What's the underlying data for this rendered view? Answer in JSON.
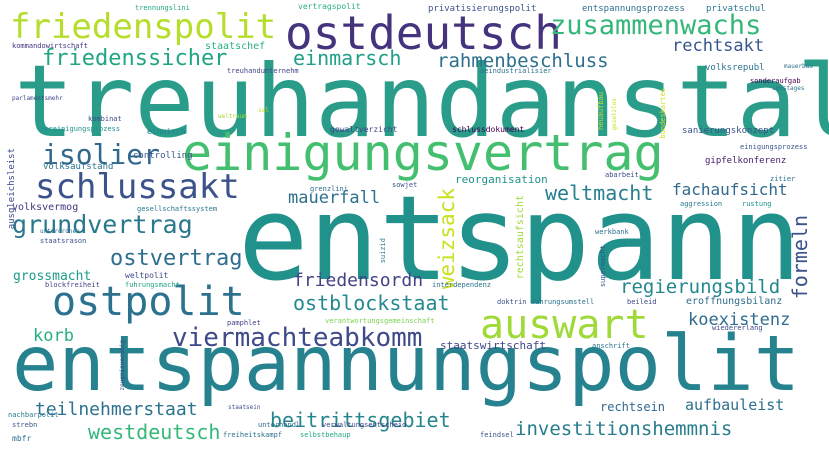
{
  "words": {
    "treuhandanstalt": "treuhandanstalt",
    "entspann": "entspann",
    "entspannungspolit": "entspannungspolit",
    "einigungsvertrag": "einigungsvertrag",
    "ostdeutsch": "ostdeutsch",
    "friedenspolit": "friedenspolit",
    "zusammenwachs": "zusammenwachs",
    "ostpolit": "ostpolit",
    "auswart": "auswart",
    "schlussakt": "schlussakt",
    "viermachteabkomm": "viermachteabkomm",
    "grundvertrag": "grundvertrag",
    "weltmacht": "weltmacht",
    "isolier": "isolier",
    "rahmenbeschluss": "rahmenbeschluss",
    "friedenssicher": "friedenssicher",
    "einmarsch": "einmarsch",
    "rechtsakt": "rechtsakt",
    "ostvertrag": "ostvertrag",
    "weizsack": "weizsack",
    "mauerfall": "mauerfall",
    "fachaufsicht": "fachaufsicht",
    "formeln": "formeln",
    "regierungsbild": "regierungsbild",
    "ostblockstaat": "ostblockstaat",
    "friedensordn": "friedensordn",
    "grossmacht": "grossmacht",
    "korb": "korb",
    "koexistenz": "koexistenz",
    "teilnehmerstaat": "teilnehmerstaat",
    "westdeutsch": "westdeutsch",
    "beitrittsgebiet": "beitrittsgebiet",
    "investitionshemmnis": "investitionshemmnis",
    "aufbauleist": "aufbauleist",
    "rechtsein": "rechtsein",
    "staatswirtschaft": "staatswirtschaft",
    "reorganisation": "reorganisation",
    "staatschef": "staatschef",
    "volksvermog": "volksvermog",
    "sanierungskonzept": "sanierungskonzept",
    "gipfelkonferenz": "gipfelkonferenz",
    "eroffnungsbilanz": "eroffnungsbilanz",
    "controlling": "controlling",
    "gewaltverzicht": "gewaltverzicht",
    "schlussdokument": "schlussdokument",
    "ausgleichsleist": "ausgleichsleist",
    "volksaufstand": "volksaufstand",
    "einmisch": "einmisch",
    "vereinigungsprozess": "vereinigungsprozess",
    "kombinat": "kombinat",
    "volksrepubl": "volksrepubl",
    "sonderaufgab": "sonderaufgab",
    "entspannungsprozess": "entspannungsprozess",
    "privatschul": "privatschul",
    "privatisierungspolit": "privatisierungspolit",
    "vertragspolit": "vertragspolit",
    "trennungslini": "trennungslini",
    "kommandowirtschaft": "kommandowirtschaft",
    "treuhandunternehm": "treuhandunternehm",
    "deindustrialisier": "deindustrialisier",
    "grenzlini": "grenzlini",
    "sowjet": "sowjet",
    "abarbeit": "abarbeit",
    "aggression": "aggression",
    "rustung": "rustung",
    "einigungsprozess": "einigungsprozess",
    "gesellschaftssystem": "gesellschaftssystem",
    "staatsrason": "staatsrason",
    "werkbank": "werkbank",
    "rechtsaufsicht": "rechtsaufsicht",
    "unterordnen": "unterordnen",
    "weltpolit": "weltpolit",
    "blockfreiheit": "blockfreiheit",
    "fuhrungsmacht": "fuhrungsmacht",
    "doktrin": "doktrin",
    "wahrungsumstell": "wahrungsumstell",
    "beileid": "beileid",
    "interdependenz": "interdependenz",
    "suizid": "suizid",
    "supermacht": "supermacht",
    "pamphlet": "pamphlet",
    "verantwortungsgemeinschaft": "verantwortungsgemeinschaft",
    "anschrift": "anschrift",
    "wiedererlang": "wiedererlang",
    "unterhandl": "unterhandl",
    "verwaltungsentscheid": "verwaltungsentscheid",
    "staatsein": "staatsein",
    "freiheitskampf": "freiheitskampf",
    "selbstbehaup": "selbstbehaup",
    "feindsel": "feindsel",
    "nachbarpolit": "nachbarpolit",
    "strebn": "strebn",
    "mbfr": "mbfr",
    "parlamentsmehr": "parlamentsmehr",
    "sonstages": "sonstages",
    "bundeskartei": "bundeskartei",
    "neuaufbau": "neuaufbau",
    "gesetzlos": "gesetzlos",
    "weltraum": "weltraum",
    "zitier": "zitier",
    "zeugnisverweig": "zeugnisverweig",
    "mauerbau": "mauerbau",
    "sal": "sal"
  }
}
